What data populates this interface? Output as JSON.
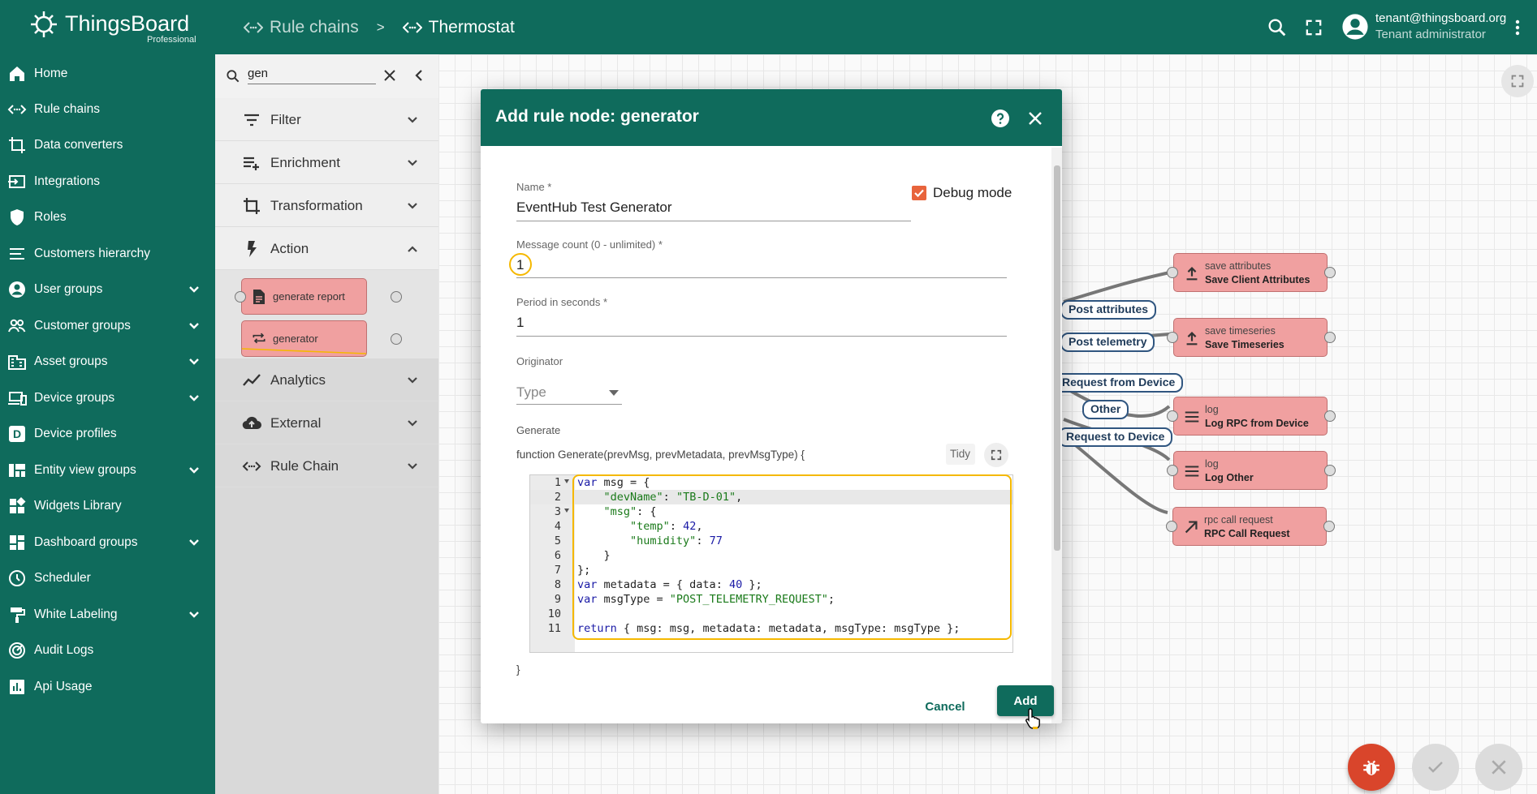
{
  "app": {
    "logo_text": "ThingsBoard",
    "logo_sub": "Professional"
  },
  "breadcrumb": {
    "first": "Rule chains",
    "separator": ">",
    "second": "Thermostat"
  },
  "user": {
    "email": "tenant@thingsboard.org",
    "role": "Tenant administrator"
  },
  "sidebar": {
    "items": [
      {
        "label": "Home",
        "icon": "home-icon"
      },
      {
        "label": "Rule chains",
        "icon": "code-icon"
      },
      {
        "label": "Data converters",
        "icon": "crop-icon"
      },
      {
        "label": "Integrations",
        "icon": "input-icon"
      },
      {
        "label": "Roles",
        "icon": "shield-icon"
      },
      {
        "label": "Customers hierarchy",
        "icon": "list-icon"
      },
      {
        "label": "User groups",
        "icon": "account-circle-icon"
      },
      {
        "label": "Customer groups",
        "icon": "people-icon"
      },
      {
        "label": "Asset groups",
        "icon": "domain-icon"
      },
      {
        "label": "Device groups",
        "icon": "devices-icon"
      },
      {
        "label": "Device profiles",
        "icon": "device-profile-icon"
      },
      {
        "label": "Entity view groups",
        "icon": "view-quilt-icon"
      },
      {
        "label": "Widgets Library",
        "icon": "widgets-icon"
      },
      {
        "label": "Dashboard groups",
        "icon": "dashboard-icon"
      },
      {
        "label": "Scheduler",
        "icon": "clock-icon"
      },
      {
        "label": "White Labeling",
        "icon": "format-paint-icon"
      },
      {
        "label": "Audit Logs",
        "icon": "track-changes-icon"
      },
      {
        "label": "Api Usage",
        "icon": "insert-chart-icon"
      }
    ]
  },
  "library": {
    "search_value": "gen",
    "categories": [
      {
        "label": "Filter"
      },
      {
        "label": "Enrichment"
      },
      {
        "label": "Transformation"
      },
      {
        "label": "Action"
      },
      {
        "label": "Analytics"
      },
      {
        "label": "External"
      },
      {
        "label": "Rule Chain"
      }
    ],
    "nodes": [
      {
        "label": "generate report"
      },
      {
        "label": "generator"
      }
    ]
  },
  "canvas": {
    "nodes": [
      {
        "type": "save attributes",
        "name": "Save Client Attributes"
      },
      {
        "type": "save timeseries",
        "name": "Save Timeseries"
      },
      {
        "type": "log",
        "name": "Log RPC from Device"
      },
      {
        "type": "log",
        "name": "Log Other"
      },
      {
        "type": "rpc call request",
        "name": "RPC Call Request"
      }
    ],
    "edge_labels": [
      "Post attributes",
      "Post telemetry",
      "Request from Device",
      "Other",
      "Request to Device"
    ]
  },
  "dialog": {
    "title": "Add rule node: generator",
    "name_label": "Name *",
    "name_value": "EventHub Test Generator",
    "debug_label": "Debug mode",
    "debug_checked": true,
    "count_label": "Message count (0 - unlimited) *",
    "count_value": "1",
    "period_label": "Period in seconds *",
    "period_value": "1",
    "originator_label": "Originator",
    "originator_placeholder": "Type",
    "generate_label": "Generate",
    "function_signature": "function Generate(prevMsg, prevMetadata, prevMsgType) {",
    "tidy_label": "Tidy",
    "closing_brace": "}",
    "code_lines": [
      "var msg = {",
      "    \"devName\": \"TB-D-01\",",
      "    \"msg\": {",
      "        \"temp\": 42,",
      "        \"humidity\": 77",
      "    }",
      "};",
      "var metadata = { data: 40 };",
      "var msgType = \"POST_TELEMETRY_REQUEST\";",
      "",
      "return { msg: msg, metadata: metadata, msgType: msgType };"
    ],
    "cancel_label": "Cancel",
    "add_label": "Add"
  },
  "colors": {
    "primary": "#0f6b5c",
    "node": "#f0a0a0",
    "highlight": "#f5b800",
    "fab_debug": "#d9452b"
  }
}
